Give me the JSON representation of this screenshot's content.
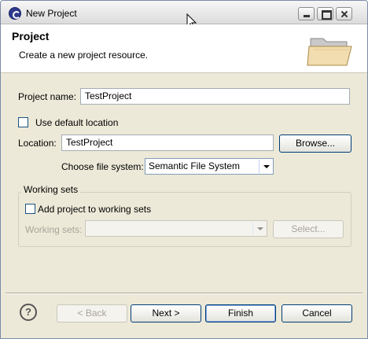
{
  "window": {
    "title": "New Project"
  },
  "banner": {
    "title": "Project",
    "description": "Create a new project resource."
  },
  "form": {
    "project_name_label": "Project name:",
    "project_name_value": "TestProject",
    "use_default_location_label": "Use default location",
    "location_label": "Location:",
    "location_value": "TestProject",
    "browse_button": "Browse...",
    "choose_fs_label": "Choose file system:",
    "file_system_selected": "Semantic File System"
  },
  "working_sets": {
    "group_title": "Working sets",
    "add_label": "Add project to working sets",
    "sets_label": "Working sets:",
    "select_button": "Select..."
  },
  "footer": {
    "help": "?",
    "back": "< Back",
    "next": "Next >",
    "finish": "Finish",
    "cancel": "Cancel"
  }
}
